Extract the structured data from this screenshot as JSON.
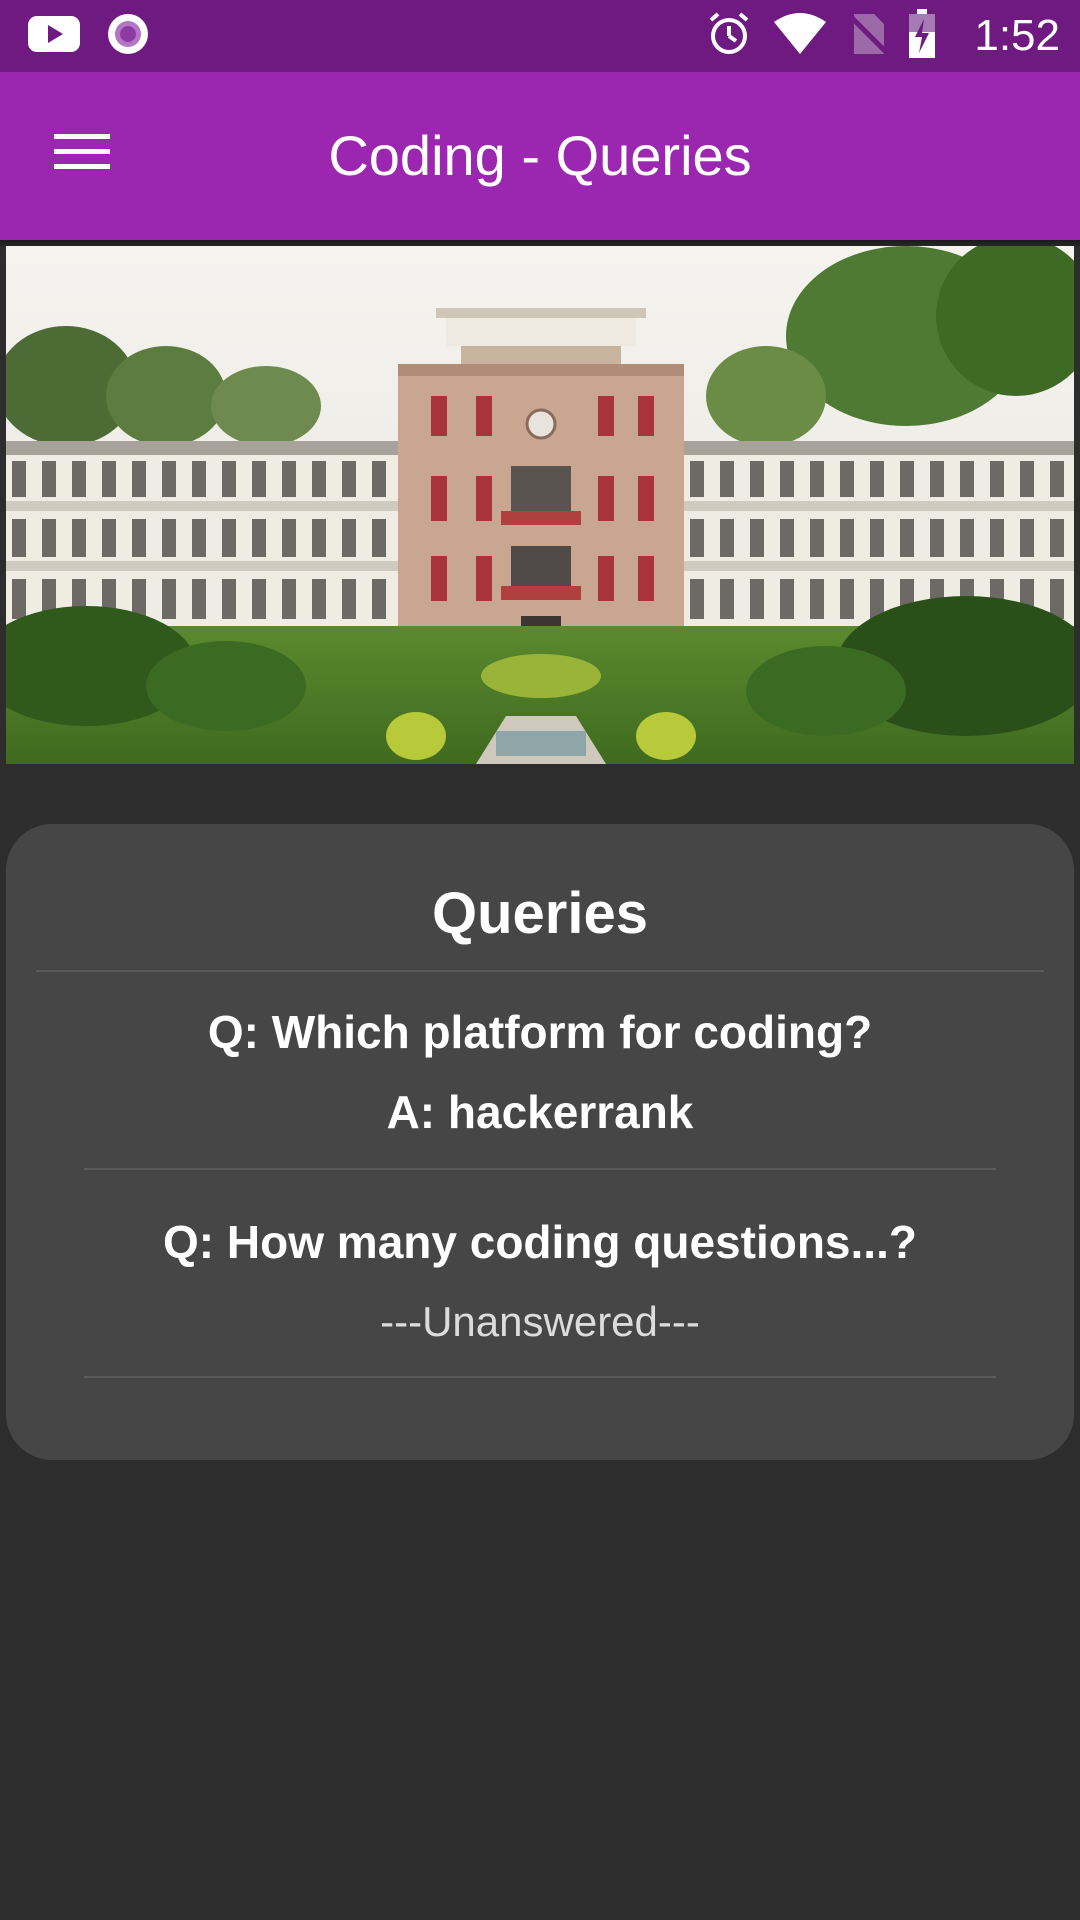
{
  "status_bar": {
    "time": "1:52",
    "left_icons": [
      "youtube-icon",
      "podcast-icon"
    ],
    "right_icons": [
      "alarm-icon",
      "wifi-icon",
      "no-sim-icon",
      "battery-charging-icon"
    ]
  },
  "app_bar": {
    "title": "Coding - Queries",
    "menu_icon": "hamburger-menu-icon"
  },
  "hero": {
    "image": "college-building-photo"
  },
  "card": {
    "title": "Queries",
    "items": [
      {
        "question": "Q: Which platform for coding?",
        "answer": "A: hackerrank",
        "answered": true
      },
      {
        "question": "Q: How many coding questions...?",
        "answer": "---Unanswered---",
        "answered": false
      }
    ]
  },
  "colors": {
    "status_bar": "#6e1a80",
    "app_bar": "#9b27b1",
    "background": "#2d2d2d",
    "card": "#464646"
  }
}
